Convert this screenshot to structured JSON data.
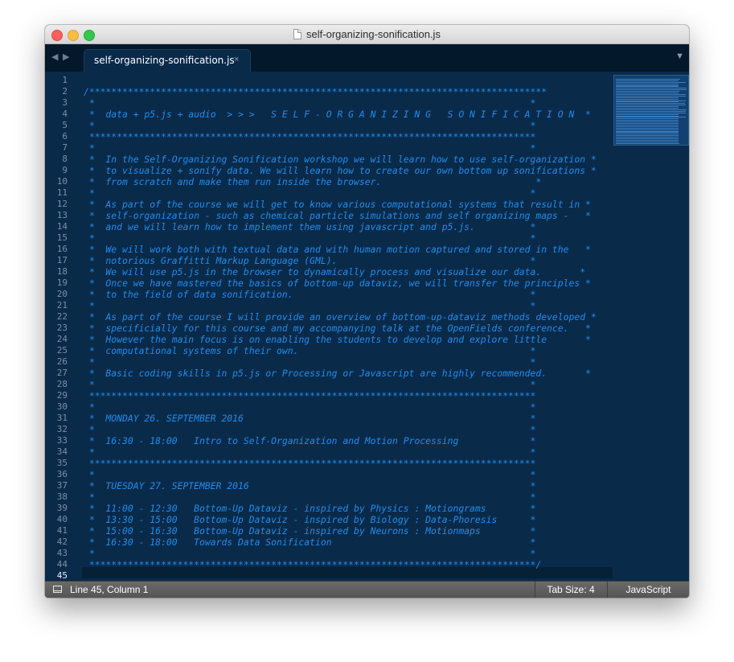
{
  "window": {
    "title": "self-organizing-sonification.js",
    "colors": {
      "editor_bg": "#0a2a4a",
      "comment": "#1e8ded",
      "gutter_text": "#7d8fa1",
      "tabbar_bg": "#03182b",
      "statusbar_bg": "#5e5e5e"
    }
  },
  "tabbar": {
    "nav_back": "◀",
    "nav_forward": "▶",
    "tab_label": "self-organizing-sonification.js",
    "tab_close": "×",
    "dropdown": "▼"
  },
  "editor": {
    "current_line": 45,
    "lines": [
      "",
      "/***********************************************************************************",
      " *                                                                               *",
      " *  data + p5.js + audio  > > >   S E L F - O R G A N I Z I N G   S O N I F I C A T I O N  *",
      " *                                                                               *",
      " *********************************************************************************",
      " *                                                                               *",
      " *  In the Self-Organizing Sonification workshop we will learn how to use self-organization *",
      " *  to visualize + sonify data. We will learn how to create our own bottom up sonifications *",
      " *  from scratch and make them run inside the browser.                            *",
      " *                                                                               *",
      " *  As part of the course we will get to know various computational systems that result in *",
      " *  self-organization - such as chemical particle simulations and self organizing maps -   *",
      " *  and we will learn how to implement them using javascript and p5.js.          *",
      " *                                                                               *",
      " *  We will work both with textual data and with human motion captured and stored in the   *",
      " *  notorious Graffitti Markup Language (GML).                                   *",
      " *  We will use p5.js in the browser to dynamically process and visualize our data.       *",
      " *  Once we have mastered the basics of bottom-up dataviz, we will transfer the principles *",
      " *  to the field of data sonification.                                           *",
      " *                                                                               *",
      " *  As part of the course I will provide an overview of bottom-up-dataviz methods developed *",
      " *  specificially for this course and my accompanying talk at the OpenFields conference.   *",
      " *  However the main focus is on enabling the students to develop and explore little       *",
      " *  computational systems of their own.                                          *",
      " *                                                                               *",
      " *  Basic coding skills in p5.js or Processing or Javascript are highly recommended.       *",
      " *                                                                               *",
      " *********************************************************************************",
      " *                                                                               *",
      " *  MONDAY 26. SEPTEMBER 2016                                                    *",
      " *                                                                               *",
      " *  16:30 - 18:00   Intro to Self-Organization and Motion Processing             *",
      " *                                                                               *",
      " *********************************************************************************",
      " *                                                                               *",
      " *  TUESDAY 27. SEPTEMBER 2016                                                   *",
      " *                                                                               *",
      " *  11:00 - 12:30   Bottom-Up Dataviz - inspired by Physics : Motiongrams        *",
      " *  13:30 - 15:00   Bottom-Up Dataviz - inspired by Biology : Data-Phoresis      *",
      " *  15:00 - 16:30   Bottom-Up Dataviz - inspired by Neurons : Motionmaps         *",
      " *  16:30 - 18:00   Towards Data Sonification                                    *",
      " *                                                                               *",
      " *********************************************************************************/",
      ""
    ]
  },
  "statusbar": {
    "position": "Line 45, Column 1",
    "tab_size": "Tab Size: 4",
    "syntax": "JavaScript"
  }
}
